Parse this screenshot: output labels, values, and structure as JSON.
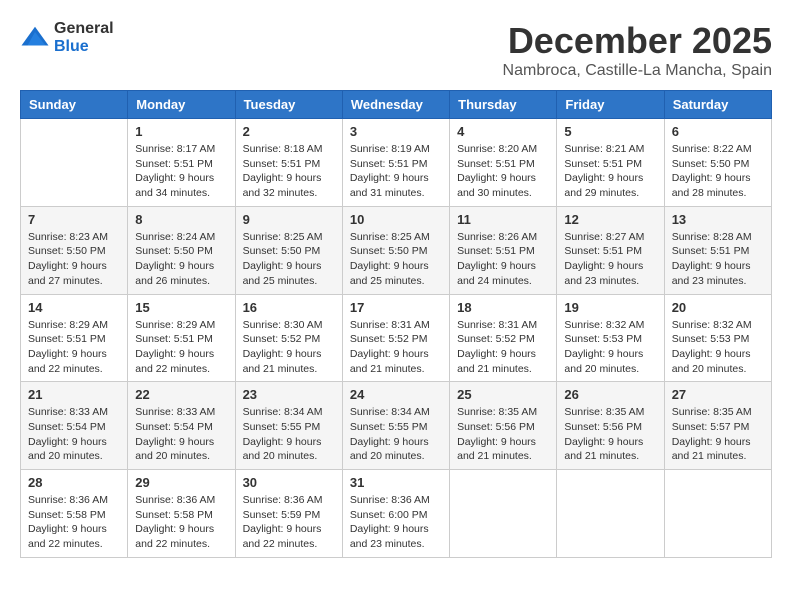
{
  "logo": {
    "general": "General",
    "blue": "Blue"
  },
  "title": "December 2025",
  "location": "Nambroca, Castille-La Mancha, Spain",
  "headers": [
    "Sunday",
    "Monday",
    "Tuesday",
    "Wednesday",
    "Thursday",
    "Friday",
    "Saturday"
  ],
  "weeks": [
    [
      {
        "day": "",
        "info": ""
      },
      {
        "day": "1",
        "info": "Sunrise: 8:17 AM\nSunset: 5:51 PM\nDaylight: 9 hours\nand 34 minutes."
      },
      {
        "day": "2",
        "info": "Sunrise: 8:18 AM\nSunset: 5:51 PM\nDaylight: 9 hours\nand 32 minutes."
      },
      {
        "day": "3",
        "info": "Sunrise: 8:19 AM\nSunset: 5:51 PM\nDaylight: 9 hours\nand 31 minutes."
      },
      {
        "day": "4",
        "info": "Sunrise: 8:20 AM\nSunset: 5:51 PM\nDaylight: 9 hours\nand 30 minutes."
      },
      {
        "day": "5",
        "info": "Sunrise: 8:21 AM\nSunset: 5:51 PM\nDaylight: 9 hours\nand 29 minutes."
      },
      {
        "day": "6",
        "info": "Sunrise: 8:22 AM\nSunset: 5:50 PM\nDaylight: 9 hours\nand 28 minutes."
      }
    ],
    [
      {
        "day": "7",
        "info": "Sunrise: 8:23 AM\nSunset: 5:50 PM\nDaylight: 9 hours\nand 27 minutes."
      },
      {
        "day": "8",
        "info": "Sunrise: 8:24 AM\nSunset: 5:50 PM\nDaylight: 9 hours\nand 26 minutes."
      },
      {
        "day": "9",
        "info": "Sunrise: 8:25 AM\nSunset: 5:50 PM\nDaylight: 9 hours\nand 25 minutes."
      },
      {
        "day": "10",
        "info": "Sunrise: 8:25 AM\nSunset: 5:50 PM\nDaylight: 9 hours\nand 25 minutes."
      },
      {
        "day": "11",
        "info": "Sunrise: 8:26 AM\nSunset: 5:51 PM\nDaylight: 9 hours\nand 24 minutes."
      },
      {
        "day": "12",
        "info": "Sunrise: 8:27 AM\nSunset: 5:51 PM\nDaylight: 9 hours\nand 23 minutes."
      },
      {
        "day": "13",
        "info": "Sunrise: 8:28 AM\nSunset: 5:51 PM\nDaylight: 9 hours\nand 23 minutes."
      }
    ],
    [
      {
        "day": "14",
        "info": "Sunrise: 8:29 AM\nSunset: 5:51 PM\nDaylight: 9 hours\nand 22 minutes."
      },
      {
        "day": "15",
        "info": "Sunrise: 8:29 AM\nSunset: 5:51 PM\nDaylight: 9 hours\nand 22 minutes."
      },
      {
        "day": "16",
        "info": "Sunrise: 8:30 AM\nSunset: 5:52 PM\nDaylight: 9 hours\nand 21 minutes."
      },
      {
        "day": "17",
        "info": "Sunrise: 8:31 AM\nSunset: 5:52 PM\nDaylight: 9 hours\nand 21 minutes."
      },
      {
        "day": "18",
        "info": "Sunrise: 8:31 AM\nSunset: 5:52 PM\nDaylight: 9 hours\nand 21 minutes."
      },
      {
        "day": "19",
        "info": "Sunrise: 8:32 AM\nSunset: 5:53 PM\nDaylight: 9 hours\nand 20 minutes."
      },
      {
        "day": "20",
        "info": "Sunrise: 8:32 AM\nSunset: 5:53 PM\nDaylight: 9 hours\nand 20 minutes."
      }
    ],
    [
      {
        "day": "21",
        "info": "Sunrise: 8:33 AM\nSunset: 5:54 PM\nDaylight: 9 hours\nand 20 minutes."
      },
      {
        "day": "22",
        "info": "Sunrise: 8:33 AM\nSunset: 5:54 PM\nDaylight: 9 hours\nand 20 minutes."
      },
      {
        "day": "23",
        "info": "Sunrise: 8:34 AM\nSunset: 5:55 PM\nDaylight: 9 hours\nand 20 minutes."
      },
      {
        "day": "24",
        "info": "Sunrise: 8:34 AM\nSunset: 5:55 PM\nDaylight: 9 hours\nand 20 minutes."
      },
      {
        "day": "25",
        "info": "Sunrise: 8:35 AM\nSunset: 5:56 PM\nDaylight: 9 hours\nand 21 minutes."
      },
      {
        "day": "26",
        "info": "Sunrise: 8:35 AM\nSunset: 5:56 PM\nDaylight: 9 hours\nand 21 minutes."
      },
      {
        "day": "27",
        "info": "Sunrise: 8:35 AM\nSunset: 5:57 PM\nDaylight: 9 hours\nand 21 minutes."
      }
    ],
    [
      {
        "day": "28",
        "info": "Sunrise: 8:36 AM\nSunset: 5:58 PM\nDaylight: 9 hours\nand 22 minutes."
      },
      {
        "day": "29",
        "info": "Sunrise: 8:36 AM\nSunset: 5:58 PM\nDaylight: 9 hours\nand 22 minutes."
      },
      {
        "day": "30",
        "info": "Sunrise: 8:36 AM\nSunset: 5:59 PM\nDaylight: 9 hours\nand 22 minutes."
      },
      {
        "day": "31",
        "info": "Sunrise: 8:36 AM\nSunset: 6:00 PM\nDaylight: 9 hours\nand 23 minutes."
      },
      {
        "day": "",
        "info": ""
      },
      {
        "day": "",
        "info": ""
      },
      {
        "day": "",
        "info": ""
      }
    ]
  ]
}
